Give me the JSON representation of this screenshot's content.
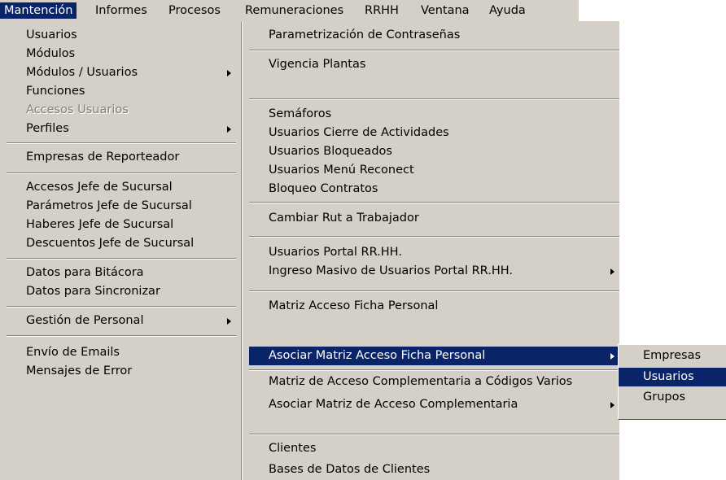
{
  "menubar": {
    "items": [
      {
        "label": "Mantención",
        "active": true
      },
      {
        "label": "Informes"
      },
      {
        "label": "Procesos"
      },
      {
        "label": "Remuneraciones"
      },
      {
        "label": "RRHH"
      },
      {
        "label": "Ventana"
      },
      {
        "label": "Ayuda"
      }
    ]
  },
  "menu_col1": {
    "items": [
      {
        "label": "Usuarios"
      },
      {
        "label": "Módulos"
      },
      {
        "label": "Módulos / Usuarios",
        "submenu": true
      },
      {
        "label": "Funciones"
      },
      {
        "label": "Accesos Usuarios",
        "disabled": true
      },
      {
        "label": "Perfiles",
        "submenu": true
      },
      {
        "label": "Empresas de Reporteador"
      },
      {
        "label": "Accesos Jefe de Sucursal"
      },
      {
        "label": "Parámetros Jefe de Sucursal"
      },
      {
        "label": "Haberes Jefe de Sucursal"
      },
      {
        "label": "Descuentos Jefe de Sucursal"
      },
      {
        "label": "Datos para Bitácora"
      },
      {
        "label": "Datos para Sincronizar"
      },
      {
        "label": "Gestión de Personal",
        "submenu": true
      },
      {
        "label": "Envío de Emails"
      },
      {
        "label": "Mensajes de Error"
      }
    ]
  },
  "menu_col2": {
    "items": [
      {
        "label": "Parametrización de Contraseñas"
      },
      {
        "label": "Vigencia Plantas"
      },
      {
        "label": "Semáforos"
      },
      {
        "label": "Usuarios Cierre de Actividades"
      },
      {
        "label": "Usuarios Bloqueados"
      },
      {
        "label": "Usuarios Menú Reconect"
      },
      {
        "label": "Bloqueo Contratos"
      },
      {
        "label": "Cambiar Rut a Trabajador"
      },
      {
        "label": "Usuarios Portal RR.HH."
      },
      {
        "label": "Ingreso Masivo de Usuarios Portal RR.HH.",
        "submenu": true
      },
      {
        "label": "Matriz Acceso Ficha Personal"
      },
      {
        "label": "Asociar Matriz Acceso Ficha Personal",
        "submenu": true,
        "highlighted": true
      },
      {
        "label": "Matriz de Acceso Complementaria a Códigos Varios"
      },
      {
        "label": "Asociar Matriz de Acceso Complementaria",
        "submenu": true
      },
      {
        "label": "Clientes"
      },
      {
        "label": "Bases de Datos de Clientes"
      }
    ]
  },
  "submenu": {
    "items": [
      {
        "label": "Empresas"
      },
      {
        "label": "Usuarios",
        "highlighted": true
      },
      {
        "label": "Grupos"
      }
    ]
  },
  "colors": {
    "menu_bg": "#d4d0c8",
    "highlight": "#0a246a",
    "highlight_text": "#ffffff",
    "disabled_text": "#808080"
  }
}
